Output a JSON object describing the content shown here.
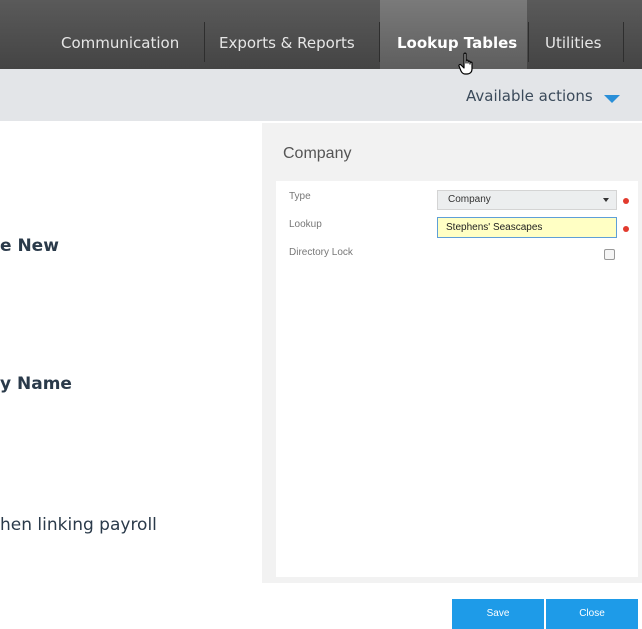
{
  "topnav": {
    "items": [
      {
        "label": "Communication",
        "active": false
      },
      {
        "label": "Exports & Reports",
        "active": false
      },
      {
        "label": "Lookup Tables",
        "active": true
      },
      {
        "label": "Utilities",
        "active": false
      }
    ]
  },
  "actionbar": {
    "available_actions": "Available actions"
  },
  "background": {
    "line1": "e New",
    "line2": "y Name",
    "line3": "hen linking payroll"
  },
  "panel": {
    "title": "Company",
    "fields": {
      "type_label": "Type",
      "type_value": "Company",
      "lookup_label": "Lookup",
      "lookup_value": "Stephens' Seascapes",
      "directory_lock_label": "Directory Lock",
      "directory_lock_checked": false
    },
    "save_label": "Save",
    "close_label": "Close"
  },
  "colors": {
    "accent": "#1e9be8",
    "required": "#e23b2e",
    "nav_bg": "#4a4a4a"
  }
}
